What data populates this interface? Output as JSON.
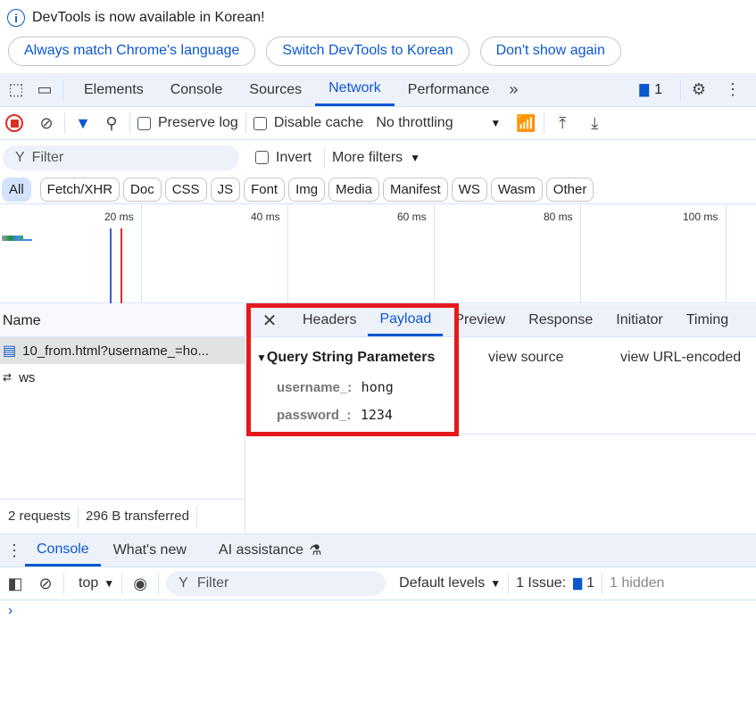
{
  "banner": {
    "message": "DevTools is now available in Korean!",
    "buttons": [
      "Always match Chrome's language",
      "Switch DevTools to Korean",
      "Don't show again"
    ]
  },
  "main_tabs": [
    "Elements",
    "Console",
    "Sources",
    "Network",
    "Performance"
  ],
  "active_tab": "Network",
  "issues_count": "1",
  "toolbar": {
    "preserve_log": "Preserve log",
    "disable_cache": "Disable cache",
    "throttling": "No throttling"
  },
  "filter": {
    "placeholder": "Filter",
    "invert": "Invert",
    "more_filters": "More filters"
  },
  "type_chips": [
    "All",
    "Fetch/XHR",
    "Doc",
    "CSS",
    "JS",
    "Font",
    "Img",
    "Media",
    "Manifest",
    "WS",
    "Wasm",
    "Other"
  ],
  "timeline_ticks": [
    "20 ms",
    "40 ms",
    "60 ms",
    "80 ms",
    "100 ms"
  ],
  "requests": {
    "header": "Name",
    "items": [
      {
        "name": "10_from.html?username_=ho...",
        "icon": "document-icon"
      },
      {
        "name": "ws",
        "icon": "websocket-icon"
      }
    ],
    "summary": [
      "2 requests",
      "296 B transferred"
    ]
  },
  "detail_tabs": [
    "Headers",
    "Payload",
    "Preview",
    "Response",
    "Initiator",
    "Timing"
  ],
  "active_detail_tab": "Payload",
  "payload": {
    "section": "Query String Parameters",
    "view_source": "view source",
    "view_encoded": "view URL-encoded",
    "params": [
      {
        "key": "username_:",
        "value": "hong"
      },
      {
        "key": "password_:",
        "value": "1234"
      }
    ]
  },
  "drawer_tabs": [
    "Console",
    "What's new",
    "AI assistance"
  ],
  "console": {
    "context": "top",
    "filter_placeholder": "Filter",
    "levels": "Default levels",
    "issues_label": "1 Issue:",
    "issues_count": "1",
    "hidden": "1 hidden"
  },
  "colors": {
    "accent": "#0b57d0",
    "highlight": "#e5191b",
    "record": "#d93025"
  }
}
